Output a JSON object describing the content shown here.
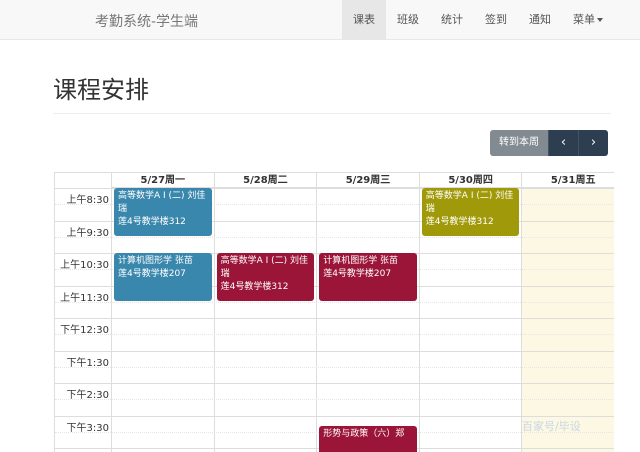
{
  "navbar": {
    "brand": "考勤系统-学生端",
    "items": [
      {
        "label": "课表",
        "active": true
      },
      {
        "label": "班级"
      },
      {
        "label": "统计"
      },
      {
        "label": "签到"
      },
      {
        "label": "通知"
      },
      {
        "label": "菜单",
        "dropdown": true
      }
    ]
  },
  "page": {
    "title": "课程安排"
  },
  "toolbar": {
    "today_label": "转到本周",
    "prev_icon": "chevron-left-icon",
    "next_icon": "chevron-right-icon"
  },
  "calendar": {
    "days": [
      "5/27周一",
      "5/28周二",
      "5/29周三",
      "5/30周四",
      "5/31周五"
    ],
    "today_index": 4,
    "times": [
      "上午8:30",
      "上午9:30",
      "上午10:30",
      "上午11:30",
      "下午12:30",
      "下午1:30",
      "下午2:30",
      "下午3:30"
    ],
    "events": [
      {
        "day": 0,
        "start": "8:30",
        "end": "10:00",
        "title": "高等数学A I (二) 刘佳瑞",
        "room": "莲4号教学楼312",
        "color": "#3a87ad"
      },
      {
        "day": 0,
        "start": "10:30",
        "end": "12:00",
        "title": "计算机图形学 张苗",
        "room": "莲4号教学楼207",
        "color": "#3a87ad"
      },
      {
        "day": 1,
        "start": "10:30",
        "end": "12:00",
        "title": "高等数学A I (二) 刘佳瑞",
        "room": "莲4号教学楼312",
        "color": "#9b1538"
      },
      {
        "day": 2,
        "start": "10:30",
        "end": "12:00",
        "title": "计算机图形学 张苗",
        "room": "莲4号教学楼207",
        "color": "#9b1538"
      },
      {
        "day": 2,
        "start": "15:50",
        "end": "17:00",
        "title": "形势与政策（六）郑",
        "room": "",
        "color": "#9b1538"
      },
      {
        "day": 3,
        "start": "8:30",
        "end": "10:00",
        "title": "高等数学A I (二) 刘佳瑞",
        "room": "莲4号教学楼312",
        "color": "#a09a0b"
      }
    ]
  },
  "watermark": "百家号/毕设"
}
